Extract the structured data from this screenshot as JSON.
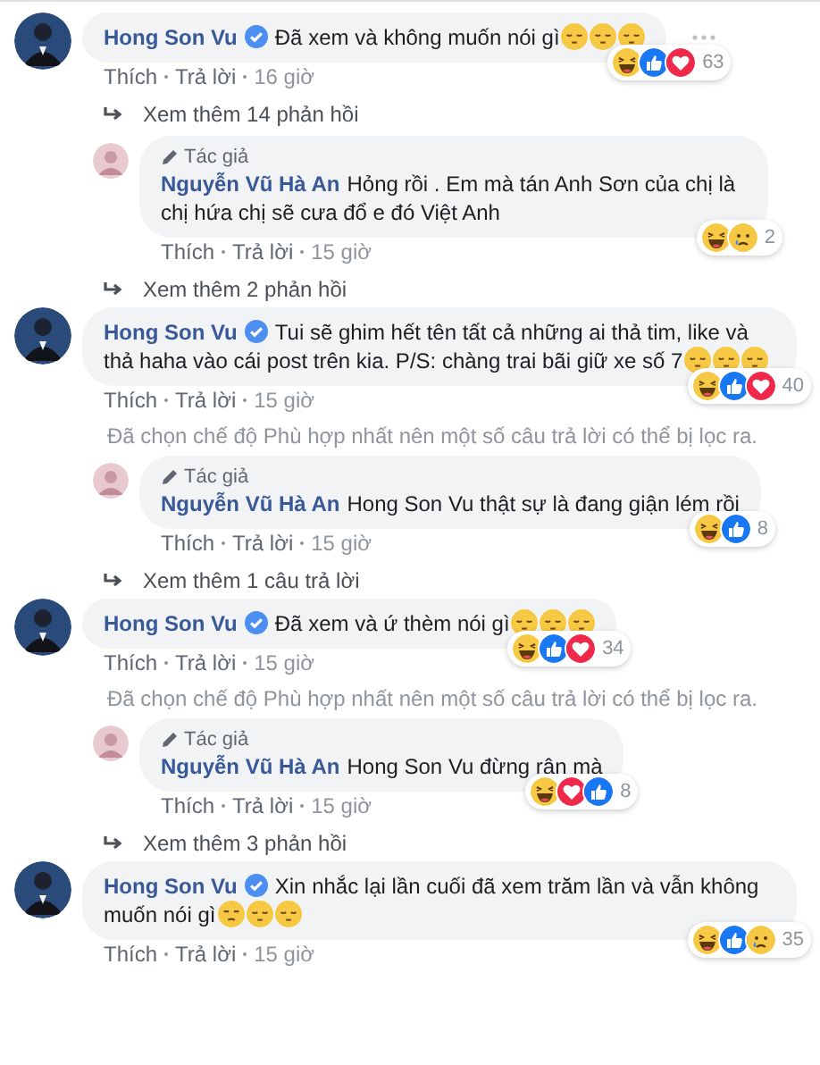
{
  "thread": [
    {
      "kind": "comment",
      "author": "Hong Son Vu",
      "verified": true,
      "text": "Đã xem và không muốn nói gì",
      "emojis": [
        {
          "kind": "pensive"
        },
        {
          "kind": "pensive"
        },
        {
          "kind": "pensive"
        }
      ],
      "reactions": [
        {
          "kind": "haha"
        },
        {
          "kind": "like"
        },
        {
          "kind": "love"
        }
      ],
      "reaction_count": "63",
      "actions": [
        "Thích",
        "Trả lời",
        "16 giờ"
      ],
      "menu_visible": true
    },
    {
      "kind": "more",
      "text": "Xem thêm 14 phản hồi"
    },
    {
      "kind": "reply",
      "badge": "Tác giả",
      "author": "Nguyễn Vũ Hà An",
      "text": "Hỏng rồi . Em mà tán Anh Sơn của chị là chị hứa chị sẽ cưa đổ e đó Việt Anh",
      "reactions": [
        {
          "kind": "haha"
        },
        {
          "kind": "sad"
        }
      ],
      "reaction_count": "2",
      "actions": [
        "Thích",
        "Trả lời",
        "15 giờ"
      ]
    },
    {
      "kind": "more",
      "text": "Xem thêm 2 phản hồi"
    },
    {
      "kind": "comment",
      "author": "Hong Son Vu",
      "verified": true,
      "text": "Tui sẽ ghim hết tên tất cả những ai thả tim, like và thả haha vào cái post trên kia. P/S: chàng trai bãi giữ xe số 7",
      "emojis": [
        {
          "kind": "pensive"
        },
        {
          "kind": "pensive"
        },
        {
          "kind": "pensive"
        }
      ],
      "reactions": [
        {
          "kind": "haha"
        },
        {
          "kind": "like"
        },
        {
          "kind": "love"
        }
      ],
      "reaction_count": "40",
      "actions": [
        "Thích",
        "Trả lời",
        "15 giờ"
      ],
      "menu_visible": false
    },
    {
      "kind": "notice",
      "text": "Đã chọn chế độ Phù hợp nhất nên một số câu trả lời có thể bị lọc ra."
    },
    {
      "kind": "reply",
      "badge": "Tác giả",
      "author": "Nguyễn Vũ Hà An",
      "text": "Hong Son Vu thật sự là đang giận lém rồi",
      "reactions": [
        {
          "kind": "haha"
        },
        {
          "kind": "like"
        }
      ],
      "reaction_count": "8",
      "actions": [
        "Thích",
        "Trả lời",
        "15 giờ"
      ]
    },
    {
      "kind": "more",
      "text": "Xem thêm 1 câu trả lời"
    },
    {
      "kind": "comment",
      "author": "Hong Son Vu",
      "verified": true,
      "text": "Đã xem và ứ thèm nói gì",
      "emojis": [
        {
          "kind": "pensive"
        },
        {
          "kind": "pensive"
        },
        {
          "kind": "pensive"
        }
      ],
      "reactions": [
        {
          "kind": "haha"
        },
        {
          "kind": "like"
        },
        {
          "kind": "love"
        }
      ],
      "reaction_count": "34",
      "actions": [
        "Thích",
        "Trả lời",
        "15 giờ"
      ],
      "menu_visible": false
    },
    {
      "kind": "notice",
      "text": "Đã chọn chế độ Phù hợp nhất nên một số câu trả lời có thể bị lọc ra."
    },
    {
      "kind": "reply",
      "badge": "Tác giả",
      "author": "Nguyễn Vũ Hà An",
      "text": "Hong Son Vu đừng rận mà",
      "reactions": [
        {
          "kind": "haha"
        },
        {
          "kind": "love"
        },
        {
          "kind": "like"
        }
      ],
      "reaction_count": "8",
      "actions": [
        "Thích",
        "Trả lời",
        "15 giờ"
      ]
    },
    {
      "kind": "more",
      "text": "Xem thêm 3 phản hồi"
    },
    {
      "kind": "comment",
      "author": "Hong Son Vu",
      "verified": true,
      "text": "Xin nhắc lại lần cuối đã xem trăm lần và vẫn không muốn nói gì",
      "emojis": [
        {
          "kind": "unamused"
        },
        {
          "kind": "pensive"
        },
        {
          "kind": "pensive"
        }
      ],
      "reactions": [
        {
          "kind": "haha"
        },
        {
          "kind": "like"
        },
        {
          "kind": "sad"
        }
      ],
      "reaction_count": "35",
      "actions": [
        "Thích",
        "Trả lời",
        "15 giờ"
      ],
      "menu_visible": false
    }
  ]
}
